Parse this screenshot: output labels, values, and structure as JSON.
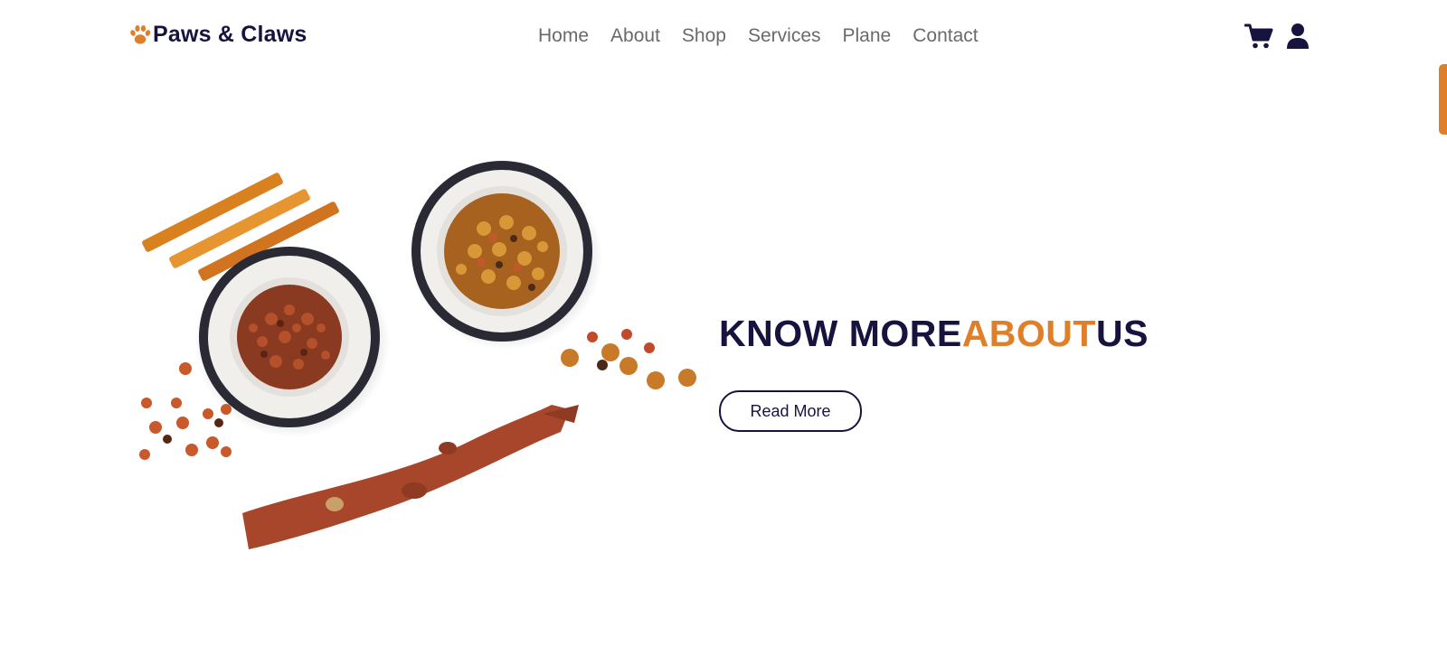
{
  "brand": {
    "name": "Paws & Claws",
    "icon": "paw-icon"
  },
  "nav": {
    "items": [
      {
        "label": "Home"
      },
      {
        "label": "About"
      },
      {
        "label": "Shop"
      },
      {
        "label": "Services"
      },
      {
        "label": "Plane"
      },
      {
        "label": "Contact"
      }
    ]
  },
  "header_icons": {
    "cart": "cart-icon",
    "user": "user-icon"
  },
  "hero": {
    "headline_part1": "KNOW MORE",
    "headline_part2": "ABOUT",
    "headline_part3": "US",
    "button_label": "Read More",
    "image": "pet-food-bowls-and-treats"
  },
  "colors": {
    "brand_dark": "#16143f",
    "accent": "#e07f29",
    "nav_text": "#6a6a6a"
  }
}
